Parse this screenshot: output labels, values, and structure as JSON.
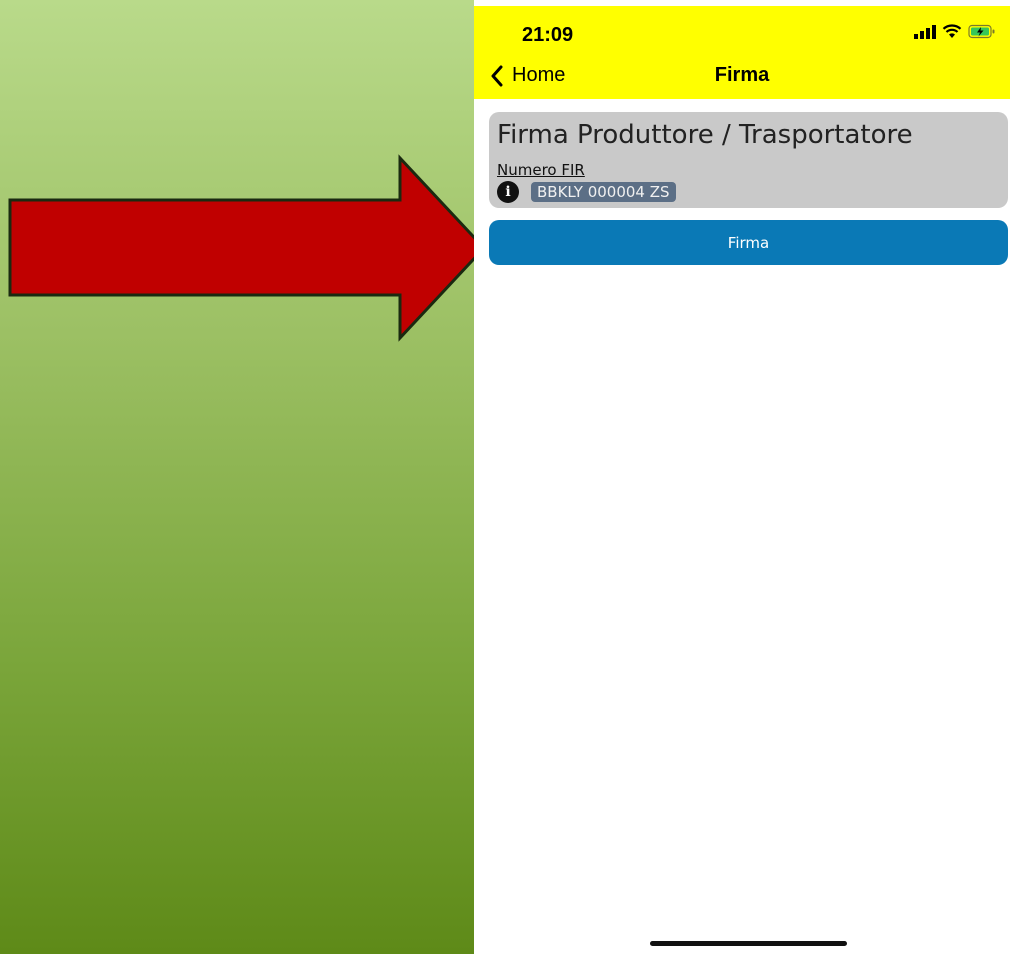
{
  "status_bar": {
    "time": "21:09"
  },
  "nav": {
    "back_label": "Home",
    "title": "Firma"
  },
  "card": {
    "title": "Firma Produttore / Trasportatore",
    "fir_label": "Numero FIR",
    "fir_value": "BBKLY 000004 ZS"
  },
  "actions": {
    "sign_label": "Firma"
  },
  "icons": {
    "back": "chevron-left-icon",
    "info": "info-icon",
    "signal": "signal-icon",
    "wifi": "wifi-icon",
    "battery": "battery-charging-icon",
    "info_glyph": "i"
  },
  "colors": {
    "header": "#ffff00",
    "button": "#0a79b6",
    "card": "#c9c9c9",
    "badge": "#5c6f86",
    "arrow": "#c00000"
  }
}
